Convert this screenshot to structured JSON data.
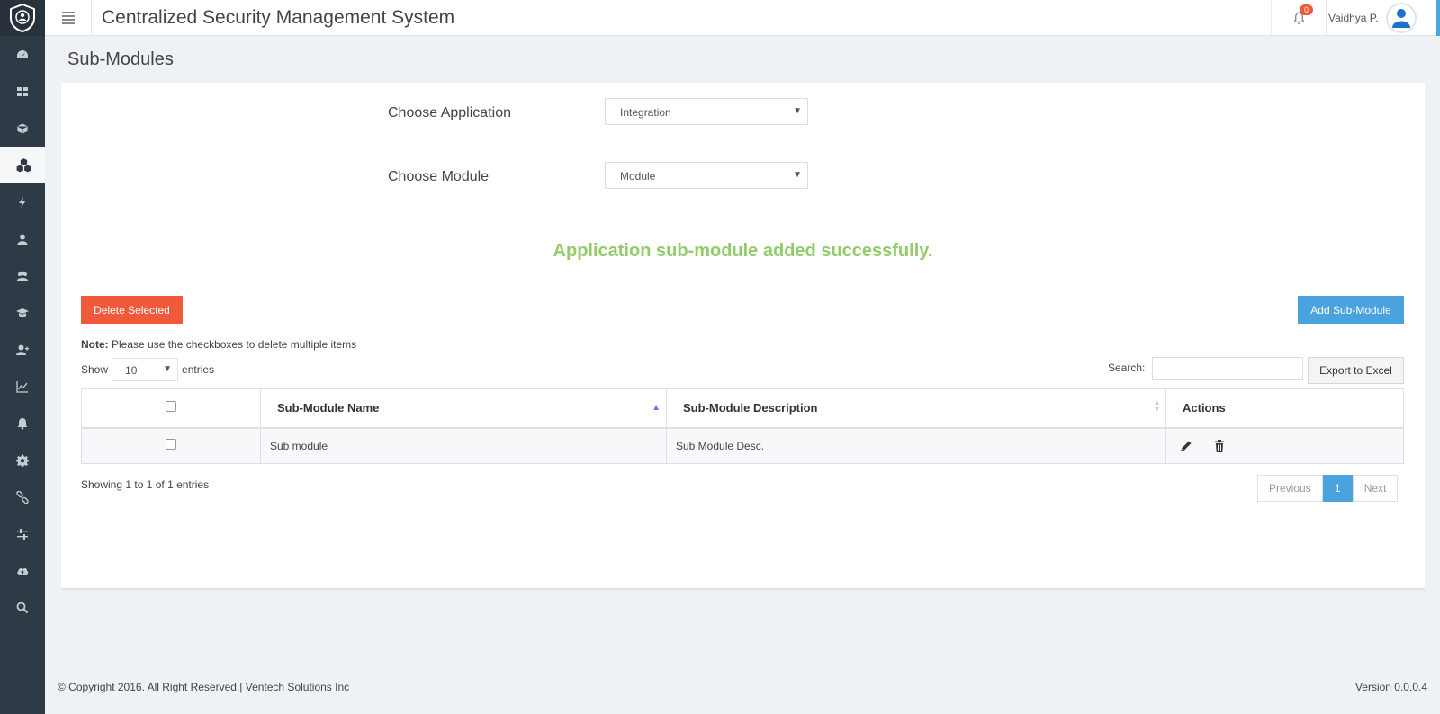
{
  "header": {
    "title": "Centralized Security Management System",
    "notification_count": "0",
    "user_name": "Vaidhya P."
  },
  "sidebar": {
    "items": [
      {
        "icon": "dashboard-icon"
      },
      {
        "icon": "grid-icon"
      },
      {
        "icon": "cube-icon"
      },
      {
        "icon": "cubes-icon",
        "active": true
      },
      {
        "icon": "bolt-icon"
      },
      {
        "icon": "user-icon"
      },
      {
        "icon": "users-icon"
      },
      {
        "icon": "graduation-cap-icon"
      },
      {
        "icon": "user-plus-icon"
      },
      {
        "icon": "line-chart-icon"
      },
      {
        "icon": "bell-icon"
      },
      {
        "icon": "gear-icon"
      },
      {
        "icon": "link-icon"
      },
      {
        "icon": "sliders-icon"
      },
      {
        "icon": "cloud-upload-icon"
      },
      {
        "icon": "search-icon"
      }
    ]
  },
  "page": {
    "title": "Sub-Modules",
    "choose_application_label": "Choose Application",
    "choose_application_value": "Integration",
    "choose_module_label": "Choose Module",
    "choose_module_value": "Module",
    "success_message": "Application sub-module added successfully.",
    "delete_selected_label": "Delete Selected",
    "add_submodule_label": "Add Sub-Module",
    "note_prefix": "Note:",
    "note_text": " Please use the checkboxes to delete multiple items",
    "show_label": "Show",
    "entries_per_page": "10",
    "entries_label": "entries",
    "search_label": "Search:",
    "search_value": "",
    "export_label": "Export to Excel"
  },
  "table": {
    "columns": [
      "Sub-Module Name",
      "Sub-Module Description",
      "Actions"
    ],
    "rows": [
      {
        "name": "Sub module",
        "description": "Sub Module Desc."
      }
    ],
    "info": "Showing 1 to 1 of 1 entries",
    "pagination": {
      "previous": "Previous",
      "current": "1",
      "next": "Next"
    }
  },
  "footer": {
    "copyright": "© Copyright 2016. All Right Reserved.| Ventech Solutions Inc",
    "version": "Version 0.0.0.4"
  },
  "colors": {
    "sidebar": "#2e3a46",
    "accent": "#4aa3df",
    "danger": "#f05a3a",
    "success": "#92cb6a"
  }
}
